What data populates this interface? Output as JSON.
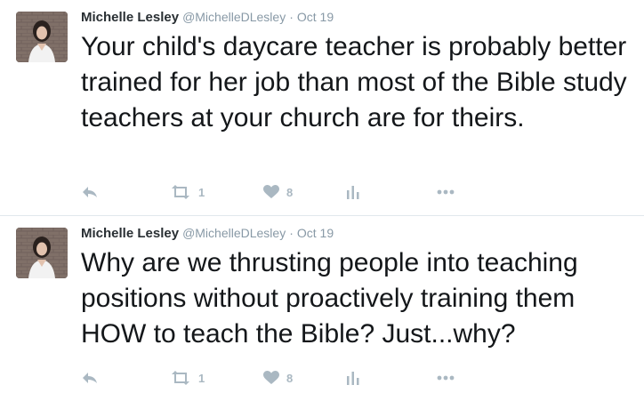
{
  "tweets": [
    {
      "name": "Michelle Lesley",
      "handle": "@MichelleDLesley",
      "separator": "·",
      "time": "Oct 19",
      "text": "Your child's daycare teacher is probably better trained for her job than most of the Bible study teachers at your church are for theirs.",
      "actions": {
        "reply_icon": "reply-icon",
        "retweet_icon": "retweet-icon",
        "retweet_count": "1",
        "like_icon": "heart-icon",
        "like_count": "8",
        "analytics_icon": "analytics-icon",
        "more_icon": "more-icon"
      }
    },
    {
      "name": "Michelle Lesley",
      "handle": "@MichelleDLesley",
      "separator": "·",
      "time": "Oct 19",
      "text": "Why are we thrusting people into teaching positions without proactively training them HOW to teach the Bible? Just...why?",
      "actions": {
        "reply_icon": "reply-icon",
        "retweet_icon": "retweet-icon",
        "retweet_count": "1",
        "like_icon": "heart-icon",
        "like_count": "8",
        "analytics_icon": "analytics-icon",
        "more_icon": "more-icon"
      }
    }
  ],
  "colors": {
    "text": "#14171a",
    "muted": "#8899a6",
    "icon": "#aab8c2",
    "divider": "#e1e8ed"
  }
}
